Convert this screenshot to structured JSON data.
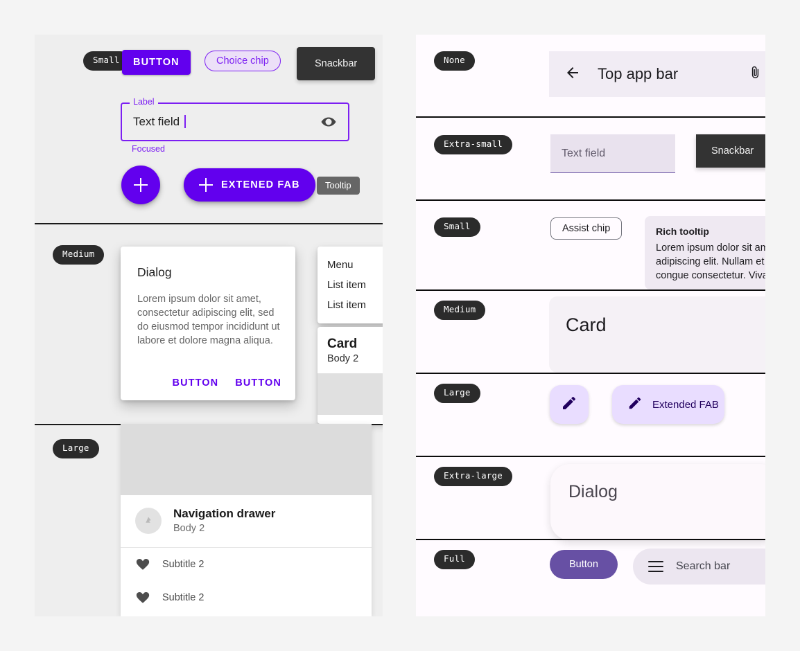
{
  "colors": {
    "page_bg": "#f4f4f4",
    "left_panel_bg": "#eeeeee",
    "right_panel_bg": "#fffbff",
    "primary_purple": "#6200ee",
    "chip_purple": "#7c1ff2",
    "tonal_purple": "#6750a4",
    "fab_container": "#e9ddff",
    "fab_on_container": "#21005e",
    "tag_bg": "#2b2b2b",
    "snackbar_bg": "#333333",
    "tooltip_bg": "#666666"
  },
  "left_panel": {
    "sections": [
      {
        "tag": "Small",
        "button_label": "BUTTON",
        "chip_label": "Choice chip",
        "snackbar_label": "Snackbar",
        "textfield": {
          "legend": "Label",
          "value": "Text field",
          "helper": "Focused",
          "trailing_icon": "eye-icon"
        },
        "fab_icon": "plus-icon",
        "extended_fab_label": "EXTENED FAB",
        "tooltip_label": "Tooltip"
      },
      {
        "tag": "Medium",
        "dialog": {
          "title": "Dialog",
          "body": "Lorem ipsum dolor sit amet, consectetur adipiscing elit, sed do eiusmod tempor incididunt ut labore et dolore magna aliqua.",
          "action_1": "BUTTON",
          "action_2": "BUTTON"
        },
        "menu": {
          "items": [
            "Menu",
            "List item",
            "List item"
          ]
        },
        "card": {
          "title": "Card",
          "body": "Body 2"
        }
      },
      {
        "tag": "Large",
        "nav_drawer": {
          "account_name": "Navigation drawer",
          "account_sub": "Body 2",
          "avatar_icon": "account-avatar-icon",
          "items": [
            {
              "icon": "heart-icon",
              "label": "Subtitle 2"
            },
            {
              "icon": "heart-icon",
              "label": "Subtitle 2"
            }
          ]
        }
      }
    ]
  },
  "right_panel": {
    "rows": [
      {
        "tag": "None",
        "top_app_bar": {
          "back_icon": "arrow-back-icon",
          "title": "Top app bar",
          "trailing_icon": "attachment-icon"
        }
      },
      {
        "tag": "Extra-small",
        "textfield_label": "Text field",
        "snackbar_label": "Snackbar"
      },
      {
        "tag": "Small",
        "assist_chip_label": "Assist chip",
        "rich_tooltip": {
          "title": "Rich tooltip",
          "line_1": "Lorem ipsum dolor sit am",
          "line_2": "adipiscing elit. Nullam et",
          "line_3": "congue consectetur. Viva"
        }
      },
      {
        "tag": "Medium",
        "card_title": "Card"
      },
      {
        "tag": "Large",
        "fab_icon": "pencil-icon",
        "extended_fab_label": "Extended FAB"
      },
      {
        "tag": "Extra-large",
        "dialog_title": "Dialog"
      },
      {
        "tag": "Full",
        "button_label": "Button",
        "search_bar": {
          "menu_icon": "hamburger-menu-icon",
          "placeholder": "Search bar"
        }
      }
    ]
  }
}
